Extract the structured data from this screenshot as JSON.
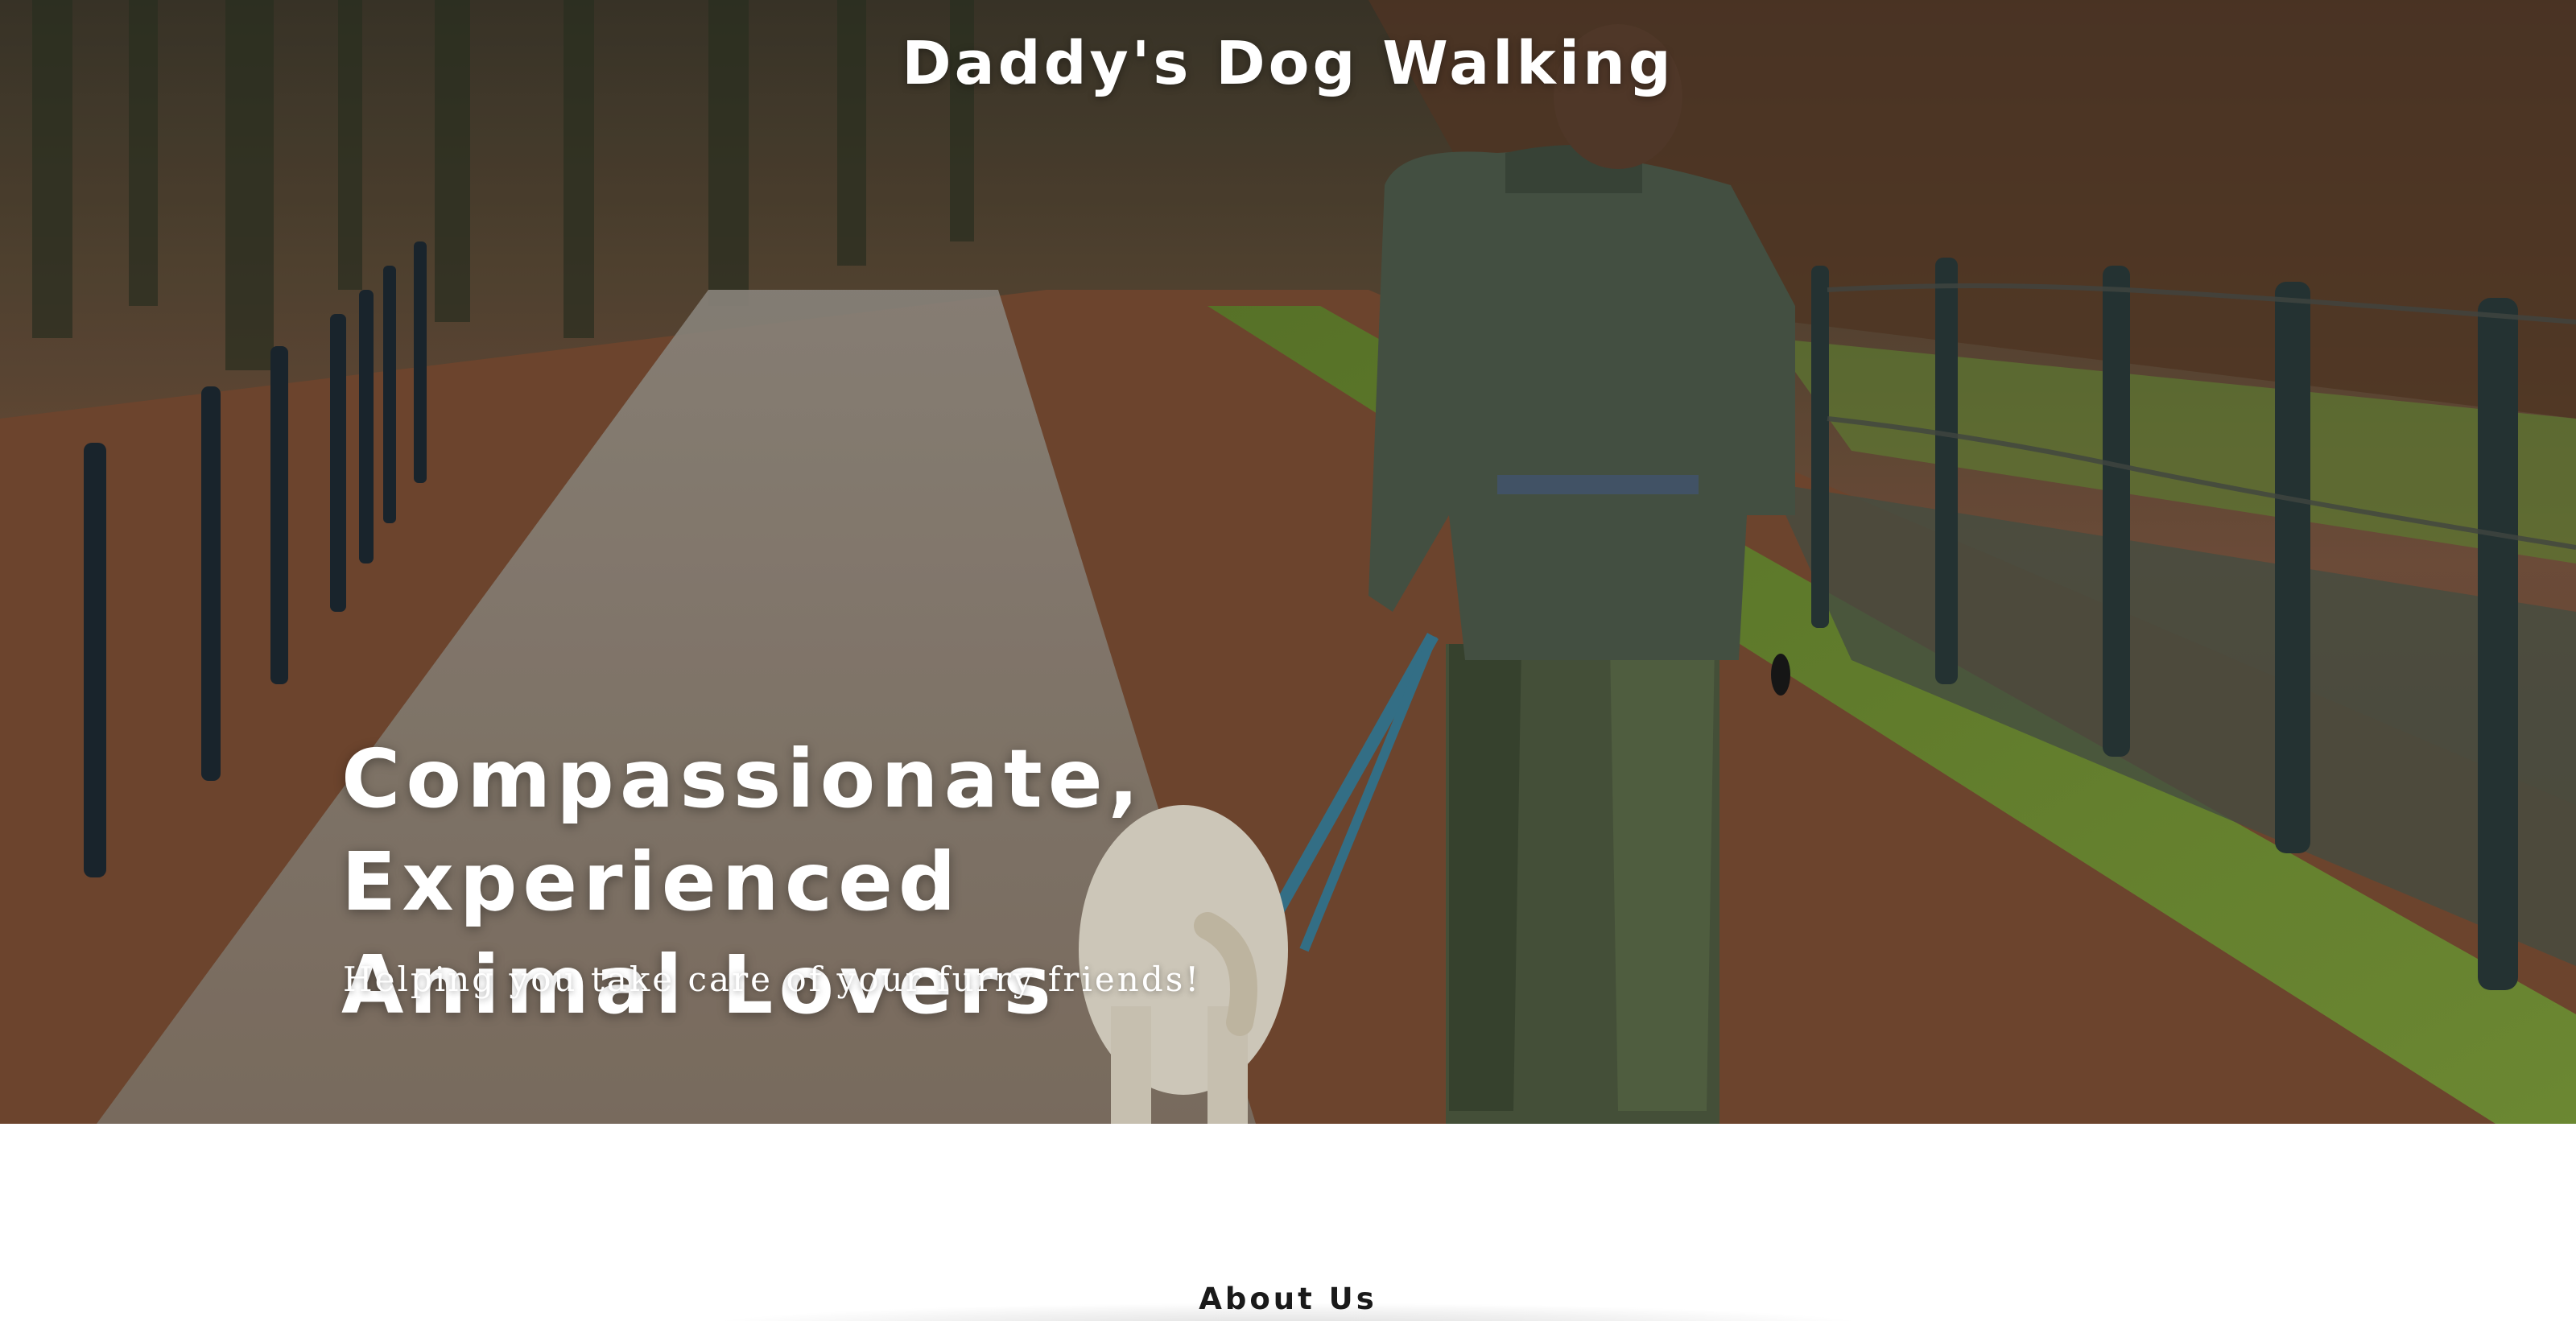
{
  "header": {
    "site_title": "Daddy's Dog Walking"
  },
  "hero": {
    "tagline_line1": "Compassionate, Experienced",
    "tagline_line2": "Animal Lovers",
    "subtitle": "Helping you take care of your furry friends!",
    "background_icon": "dog-walker-photo"
  },
  "about": {
    "heading": "About Us"
  },
  "colors": {
    "text_on_hero": "#ffffff",
    "heading_dark": "#1a1a1a",
    "page_bg": "#ffffff"
  }
}
